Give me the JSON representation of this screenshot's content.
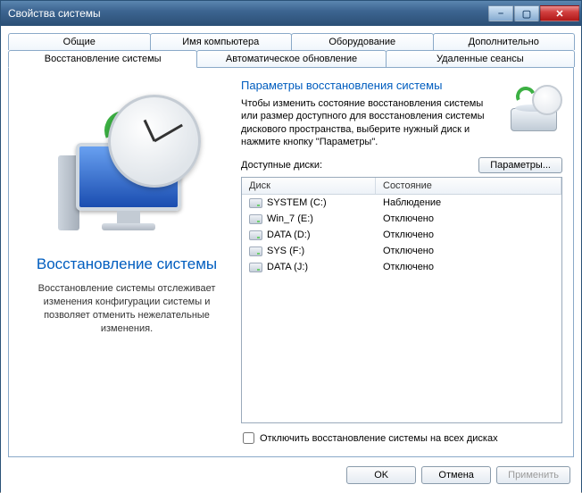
{
  "window": {
    "title": "Свойства системы"
  },
  "tabs_row1": [
    {
      "label": "Общие"
    },
    {
      "label": "Имя компьютера"
    },
    {
      "label": "Оборудование"
    },
    {
      "label": "Дополнительно"
    }
  ],
  "tabs_row2": [
    {
      "label": "Восстановление системы",
      "active": true
    },
    {
      "label": "Автоматическое обновление"
    },
    {
      "label": "Удаленные сеансы"
    }
  ],
  "left": {
    "heading": "Восстановление системы",
    "desc": "Восстановление системы отслеживает изменения конфигурации системы и позволяет отменить нежелательные изменения."
  },
  "right": {
    "heading": "Параметры восстановления системы",
    "desc": "Чтобы изменить состояние восстановления системы или размер доступного для восстановления системы дискового пространства, выберите нужный диск и нажмите кнопку \"Параметры\".",
    "avail_label": "Доступные диски:",
    "settings_btn": "Параметры...",
    "columns": {
      "disk": "Диск",
      "state": "Состояние"
    },
    "drives": [
      {
        "name": "SYSTEM (C:)",
        "state": "Наблюдение"
      },
      {
        "name": "Win_7 (E:)",
        "state": "Отключено"
      },
      {
        "name": "DATA (D:)",
        "state": "Отключено"
      },
      {
        "name": "SYS (F:)",
        "state": "Отключено"
      },
      {
        "name": "DATA (J:)",
        "state": "Отключено"
      }
    ],
    "disable_all": "Отключить восстановление системы на всех дисках"
  },
  "footer": {
    "ok": "OK",
    "cancel": "Отмена",
    "apply": "Применить"
  }
}
